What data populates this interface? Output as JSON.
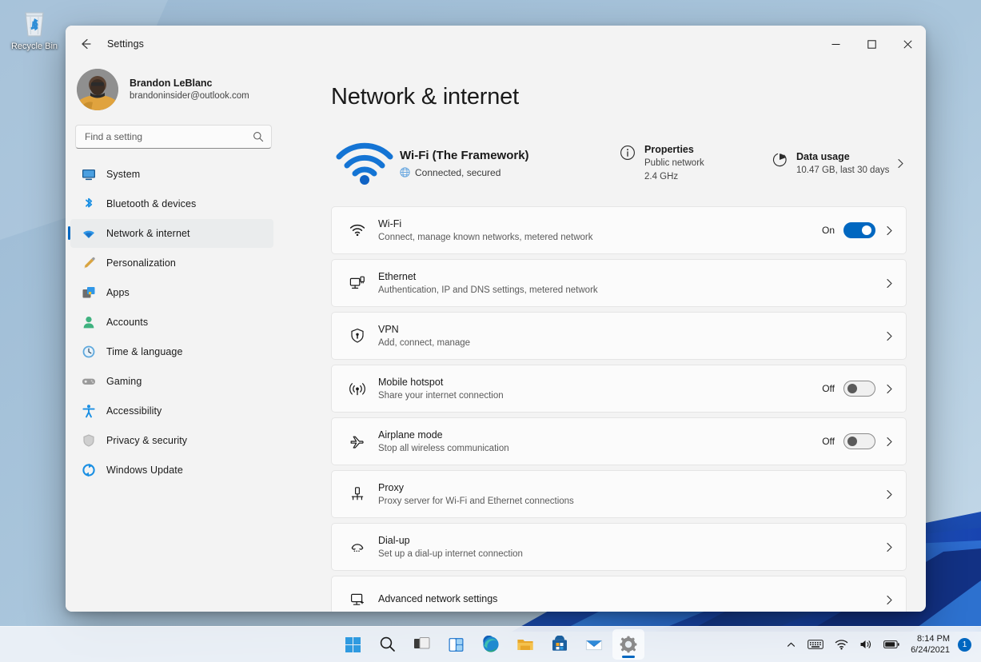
{
  "desktop": {
    "recycle_bin_label": "Recycle Bin",
    "recycle_bin_icon": "recycle-bin-icon"
  },
  "window": {
    "title": "Settings",
    "back_icon": "back-arrow-icon",
    "minimize_label": "—",
    "maximize_label": "☐",
    "close_label": "✕"
  },
  "sidebar": {
    "account": {
      "name": "Brandon LeBlanc",
      "email": "brandoninsider@outlook.com",
      "avatar_icon": "user-avatar"
    },
    "search": {
      "placeholder": "Find a setting",
      "value": "",
      "icon": "search-icon"
    },
    "items": [
      {
        "label": "System",
        "icon": "system-icon",
        "selected": false
      },
      {
        "label": "Bluetooth & devices",
        "icon": "bluetooth-icon",
        "selected": false
      },
      {
        "label": "Network & internet",
        "icon": "network-icon",
        "selected": true
      },
      {
        "label": "Personalization",
        "icon": "personalization-icon",
        "selected": false
      },
      {
        "label": "Apps",
        "icon": "apps-icon",
        "selected": false
      },
      {
        "label": "Accounts",
        "icon": "accounts-icon",
        "selected": false
      },
      {
        "label": "Time & language",
        "icon": "time-language-icon",
        "selected": false
      },
      {
        "label": "Gaming",
        "icon": "gaming-icon",
        "selected": false
      },
      {
        "label": "Accessibility",
        "icon": "accessibility-icon",
        "selected": false
      },
      {
        "label": "Privacy & security",
        "icon": "privacy-security-icon",
        "selected": false
      },
      {
        "label": "Windows Update",
        "icon": "windows-update-icon",
        "selected": false
      }
    ]
  },
  "main": {
    "page_title": "Network & internet",
    "status": {
      "wifi_icon": "wifi-signal-icon",
      "title": "Wi-Fi (The Framework)",
      "status_icon": "globe-icon",
      "status_text": "Connected, secured",
      "properties": {
        "icon": "info-icon",
        "title": "Properties",
        "line1": "Public network",
        "line2": "2.4 GHz"
      },
      "data_usage": {
        "icon": "pie-chart-icon",
        "title": "Data usage",
        "line1": "10.47 GB, last 30 days"
      },
      "chevron": "chevron-right-icon"
    },
    "cards": [
      {
        "icon": "wifi-icon",
        "title": "Wi-Fi",
        "desc": "Connect, manage known networks, metered network",
        "toggle": {
          "state": "on",
          "label": "On"
        }
      },
      {
        "icon": "ethernet-icon",
        "title": "Ethernet",
        "desc": "Authentication, IP and DNS settings, metered network",
        "toggle": null
      },
      {
        "icon": "vpn-shield-icon",
        "title": "VPN",
        "desc": "Add, connect, manage",
        "toggle": null
      },
      {
        "icon": "mobile-hotspot-icon",
        "title": "Mobile hotspot",
        "desc": "Share your internet connection",
        "toggle": {
          "state": "off",
          "label": "Off"
        }
      },
      {
        "icon": "airplane-icon",
        "title": "Airplane mode",
        "desc": "Stop all wireless communication",
        "toggle": {
          "state": "off",
          "label": "Off"
        }
      },
      {
        "icon": "proxy-icon",
        "title": "Proxy",
        "desc": "Proxy server for Wi-Fi and Ethernet connections",
        "toggle": null
      },
      {
        "icon": "dialup-icon",
        "title": "Dial-up",
        "desc": "Set up a dial-up internet connection",
        "toggle": null
      },
      {
        "icon": "advanced-network-icon",
        "title": "Advanced network settings",
        "desc": "",
        "toggle": null
      }
    ]
  },
  "taskbar": {
    "items": [
      {
        "name": "start-button",
        "label": "Start"
      },
      {
        "name": "search-button",
        "label": "Search"
      },
      {
        "name": "task-view-button",
        "label": "Task View"
      },
      {
        "name": "widgets-button",
        "label": "Widgets"
      },
      {
        "name": "edge-button",
        "label": "Microsoft Edge"
      },
      {
        "name": "file-explorer-button",
        "label": "File Explorer"
      },
      {
        "name": "microsoft-store-button",
        "label": "Microsoft Store"
      },
      {
        "name": "mail-button",
        "label": "Mail"
      },
      {
        "name": "settings-button",
        "label": "Settings",
        "active": true
      }
    ],
    "tray": {
      "chevron_up_icon": "show-hidden-icons-icon",
      "keyboard_icon": "keyboard-layout-icon",
      "wifi_icon": "wifi-tray-icon",
      "volume_icon": "volume-icon",
      "battery_icon": "battery-icon",
      "time": "8:14 PM",
      "date": "6/24/2021",
      "notification_count": "1"
    }
  },
  "colors": {
    "accent": "#0067c0",
    "window_bg": "#f3f3f3",
    "card_bg": "#fbfbfb",
    "selected_nav": "#eaeced"
  }
}
